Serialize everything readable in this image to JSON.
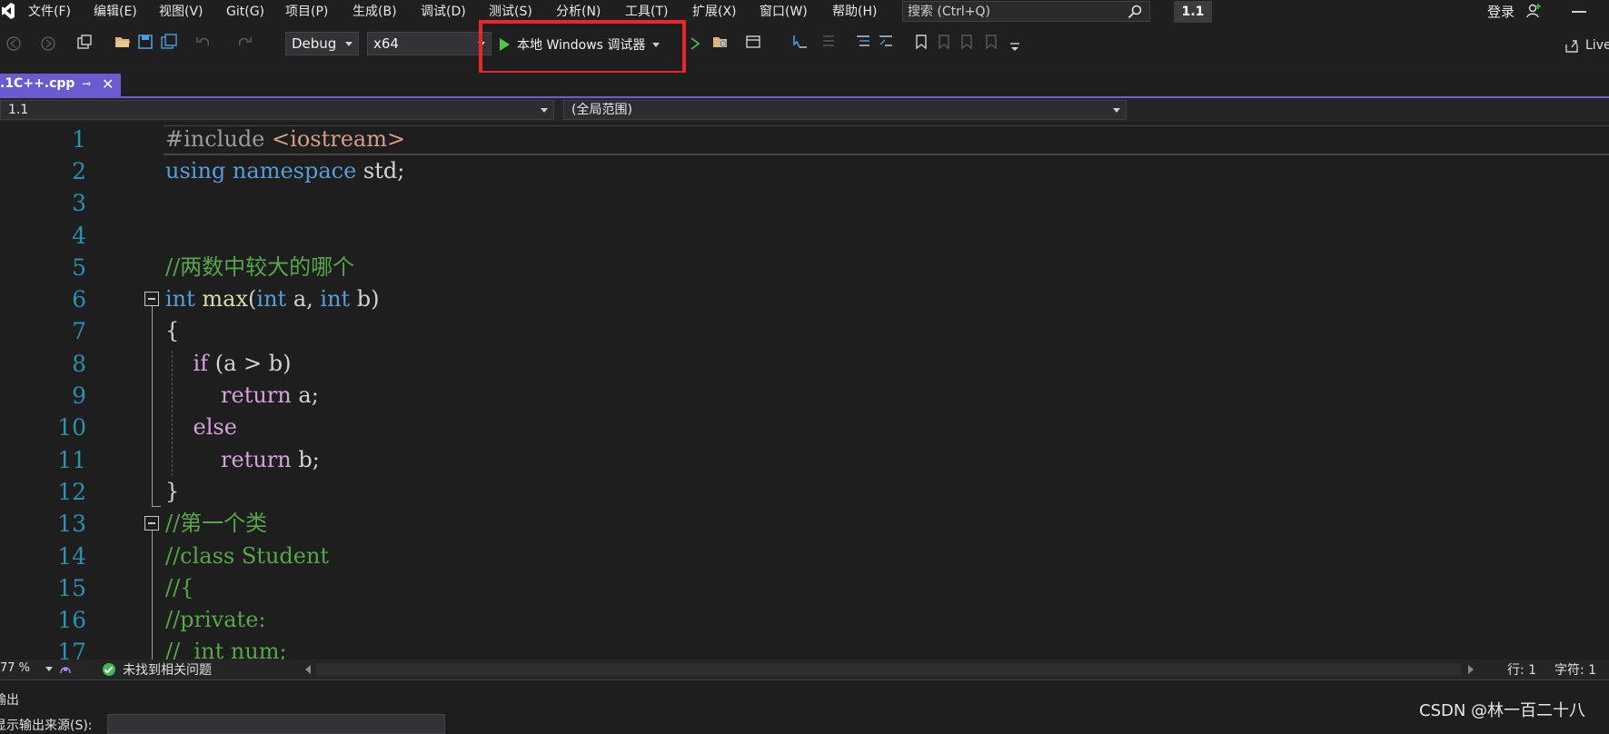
{
  "menu": {
    "items": [
      "文件(F)",
      "编辑(E)",
      "视图(V)",
      "Git(G)",
      "项目(P)",
      "生成(B)",
      "调试(D)",
      "测试(S)",
      "分析(N)",
      "工具(T)",
      "扩展(X)",
      "窗口(W)",
      "帮助(H)"
    ],
    "search_placeholder": "搜索 (Ctrl+Q)",
    "solution_badge": "1.1",
    "login_label": "登录"
  },
  "toolbar": {
    "configuration": "Debug",
    "platform": "x64",
    "run_label": "本地 Windows 调试器",
    "live_share_label": "Live",
    "highlight_color": "#e8262b"
  },
  "tab": {
    "file_name": ".1C++.cpp",
    "pin_glyph": "⊸",
    "close_glyph": "✕"
  },
  "navbar": {
    "project": "1.1",
    "scope": "(全局范围)"
  },
  "editor": {
    "line_numbers": [
      "1",
      "2",
      "3",
      "4",
      "5",
      "6",
      "7",
      "8",
      "9",
      "10",
      "11",
      "12",
      "13",
      "14",
      "15",
      "16",
      "17"
    ],
    "lines": [
      "#include <iostream>",
      "using namespace std;",
      "",
      "",
      "//两数中较大的哪个",
      "int max(int a, int b)",
      "{",
      "    if (a > b)",
      "        return a;",
      "    else",
      "        return b;",
      "}",
      "//第一个类",
      "//class Student",
      "//{",
      "//private:",
      "//  int num;"
    ]
  },
  "status": {
    "zoom": "77 %",
    "issues": "未找到相关问题",
    "line": "行: 1",
    "char": "字符: 1"
  },
  "output": {
    "title": "输出",
    "source_label": "显示输出来源(S):"
  },
  "watermark": "CSDN @林一百二十八"
}
